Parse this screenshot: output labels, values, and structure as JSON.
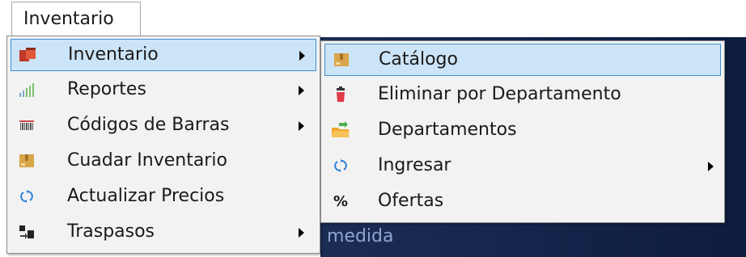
{
  "menubar": {
    "label": "Inventario"
  },
  "background": {
    "partial_text": "medida"
  },
  "primary_menu": {
    "items": [
      {
        "label": "Inventario",
        "icon": "boxes-icon",
        "submenu": true,
        "highlighted": true
      },
      {
        "label": "Reportes",
        "icon": "bar-chart-icon",
        "submenu": true
      },
      {
        "label": "Códigos de Barras",
        "icon": "barcode-icon",
        "submenu": true
      },
      {
        "label": "Cuadar Inventario",
        "icon": "package-icon",
        "submenu": false
      },
      {
        "label": "Actualizar Precios",
        "icon": "refresh-icon",
        "submenu": false
      },
      {
        "label": "Traspasos",
        "icon": "transfer-icon",
        "submenu": true
      }
    ]
  },
  "secondary_menu": {
    "items": [
      {
        "label": "Catálogo",
        "icon": "package-icon",
        "submenu": false,
        "highlighted": true
      },
      {
        "label": "Eliminar por Departamento",
        "icon": "trash-icon",
        "submenu": false
      },
      {
        "label": "Departamentos",
        "icon": "folder-icon",
        "submenu": false
      },
      {
        "label": "Ingresar",
        "icon": "refresh-icon",
        "submenu": true
      },
      {
        "label": "Ofertas",
        "icon": "percent-icon",
        "submenu": false,
        "icon_text": "%"
      }
    ]
  },
  "colors": {
    "highlight_bg": "#cce4f7",
    "highlight_border": "#3d8fd6",
    "menu_bg": "#f2f2f2"
  }
}
